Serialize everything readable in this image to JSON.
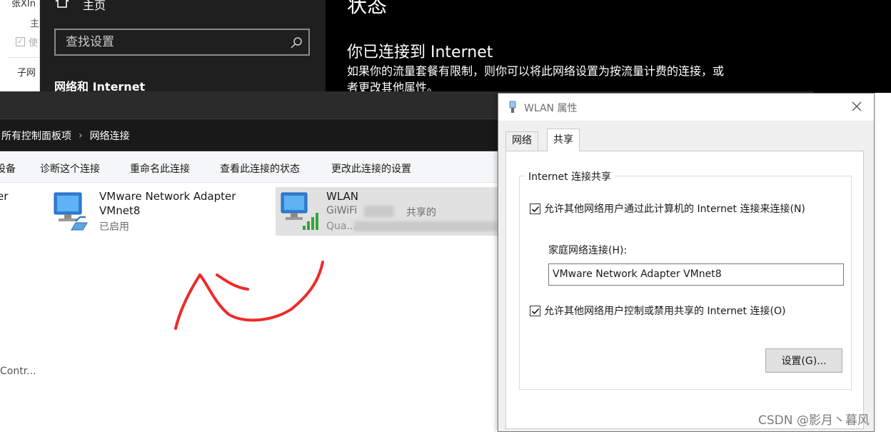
{
  "left_sliver": {
    "text1": "张XIn",
    "text2": "主",
    "checkbox_label": "使",
    "text4": "子网"
  },
  "settings": {
    "home_label": "主页",
    "search_placeholder": "查找设置",
    "nav_heading": "网络和 Internet",
    "status_title": "状态",
    "connected_text": "你已连接到 Internet",
    "metered_desc": "如果你的流量套餐有限制，则你可以将此网络设置为按流量计费的连接，或者更改其他属性。"
  },
  "network_connections": {
    "breadcrumb": {
      "parent": "所有控制面板项",
      "separator": "›",
      "current": "网络连接"
    },
    "toolbar": [
      "设备",
      "诊断这个连接",
      "重命名此连接",
      "查看此连接的状态",
      "更改此连接的设置"
    ],
    "adapters": [
      {
        "name": "er"
      },
      {
        "name": "VMware Network Adapter",
        "name2": "VMnet8",
        "status": "已启用"
      },
      {
        "name": "WLAN",
        "network": "GiWiFi",
        "status": "共享的",
        "device": "Qua..."
      }
    ],
    "bottom_text": "Contr..."
  },
  "wlan_dialog": {
    "title": "WLAN 属性",
    "tabs": [
      "网络",
      "共享"
    ],
    "active_tab": "共享",
    "group_title": "Internet 连接共享",
    "allow_connect_label": "允许其他网络用户通过此计算机的 Internet 连接来连接(N)",
    "allow_connect_checked": true,
    "home_connection_label": "家庭网络连接(H):",
    "home_connection_value": "VMware Network Adapter VMnet8",
    "allow_control_label": "允许其他网络用户控制或禁用共享的 Internet 连接(O)",
    "allow_control_checked": true,
    "settings_button": "设置(G)..."
  },
  "watermark": "CSDN @影月丶暮风",
  "colors": {
    "settings_bg": "#000000",
    "settings_nav_bg": "#1f1f1f",
    "addressbar_bg": "#191919",
    "toolbar_bg": "#f5f6f7",
    "dialog_bg": "#f0f0f0",
    "annotation": "#ef2a2a"
  }
}
